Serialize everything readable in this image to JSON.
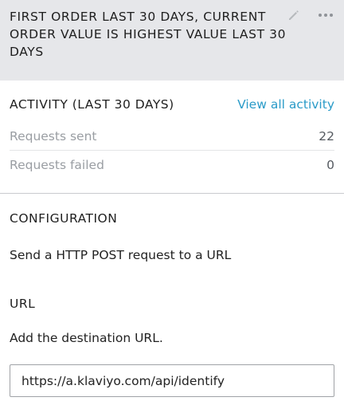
{
  "header": {
    "title": "FIRST ORDER LAST 30 DAYS, CURRENT ORDER VALUE IS HIGHEST VALUE LAST 30 DAYS",
    "edit_icon": "pencil-icon",
    "more_icon": "more-horizontal-icon"
  },
  "activity": {
    "title": "ACTIVITY (LAST 30 DAYS)",
    "view_all_label": "View all activity",
    "rows": [
      {
        "label": "Requests sent",
        "value": "22"
      },
      {
        "label": "Requests failed",
        "value": "0"
      }
    ]
  },
  "configuration": {
    "title": "CONFIGURATION",
    "description": "Send a HTTP POST request to a URL"
  },
  "url": {
    "title": "URL",
    "description": "Add the destination URL.",
    "value": "https://a.klaviyo.com/api/identify"
  },
  "colors": {
    "header_bg": "#e6e7ea",
    "link": "#2a9bc8",
    "muted_text": "#9a9ea3"
  }
}
